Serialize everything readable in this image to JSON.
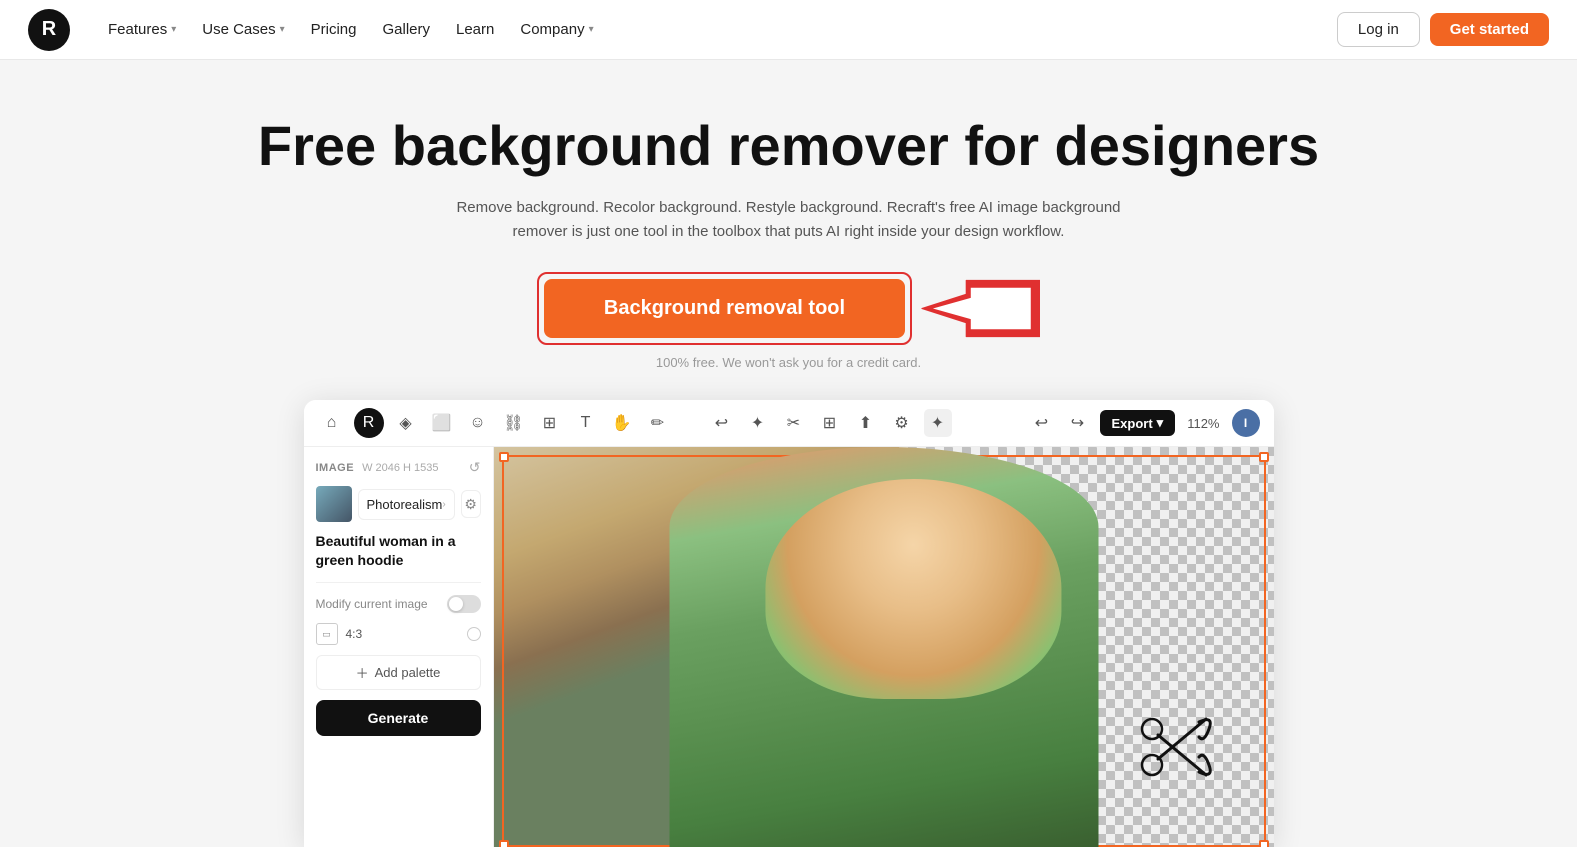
{
  "nav": {
    "logo": "R",
    "links": [
      {
        "label": "Features",
        "hasDropdown": true
      },
      {
        "label": "Use Cases",
        "hasDropdown": true
      },
      {
        "label": "Pricing",
        "hasDropdown": false,
        "active": false
      },
      {
        "label": "Gallery",
        "hasDropdown": false
      },
      {
        "label": "Learn",
        "hasDropdown": false
      },
      {
        "label": "Company",
        "hasDropdown": true
      }
    ],
    "login_label": "Log in",
    "getstarted_label": "Get started"
  },
  "hero": {
    "title": "Free background remover for designers",
    "subtitle": "Remove background. Recolor background. Restyle background. Recraft's free AI image background remover is just one tool in the toolbox that puts AI right inside your design workflow.",
    "cta_button": "Background removal tool",
    "cta_note": "100% free. We won't ask you for a credit card."
  },
  "app": {
    "toolbar": {
      "export_label": "Export",
      "zoom_level": "112%",
      "user_initial": "I"
    },
    "left_panel": {
      "section_label": "IMAGE",
      "dimensions": "W 2046  H 1535",
      "style_label": "Photorealism",
      "description": "Beautiful woman in a green hoodie",
      "modify_label": "Modify current image",
      "ratio_label": "4:3",
      "add_palette_label": "+ Add palette",
      "generate_label": "Generate"
    }
  }
}
